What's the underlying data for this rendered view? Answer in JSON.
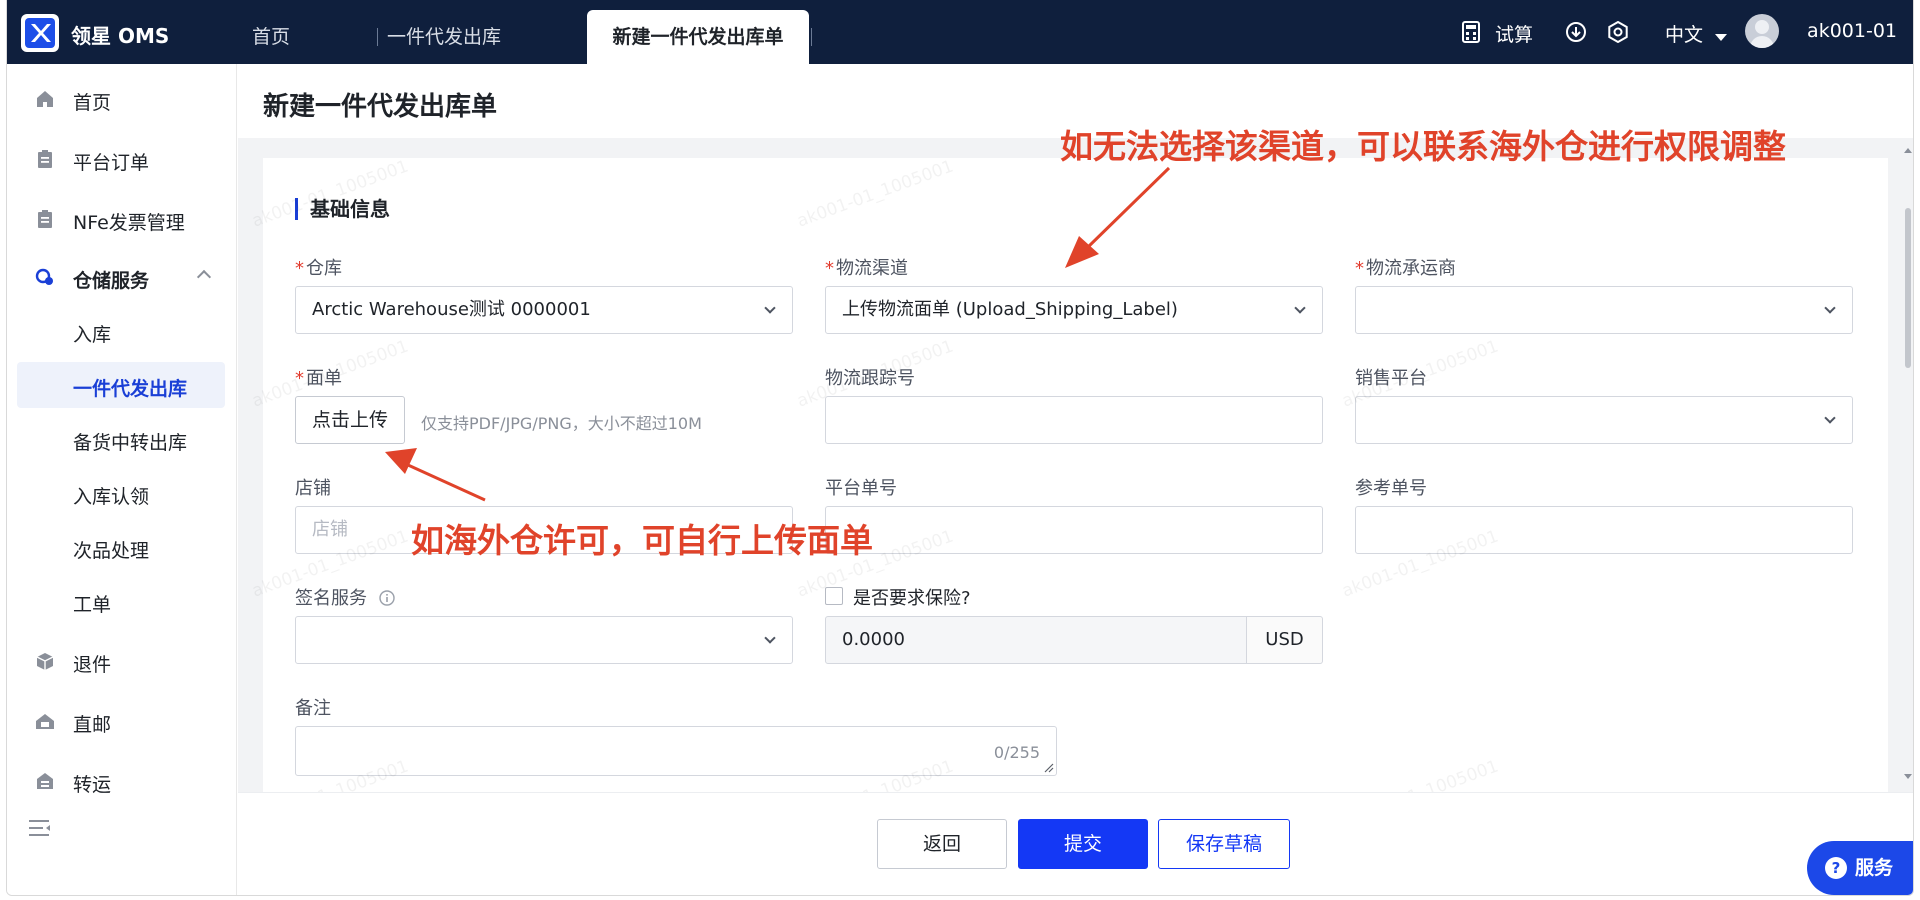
{
  "app": {
    "name": "领星 OMS"
  },
  "tabs": [
    {
      "label": "首页"
    },
    {
      "label": "一件代发出库"
    },
    {
      "label": "新建一件代发出库单"
    }
  ],
  "header": {
    "trial_label": "试算",
    "language": "中文",
    "user": "ak001-01"
  },
  "sidebar": {
    "items": [
      {
        "label": "首页",
        "icon": "home-icon"
      },
      {
        "label": "平台订单",
        "icon": "clipboard-icon"
      },
      {
        "label": "NFe发票管理",
        "icon": "clipboard-icon"
      },
      {
        "label": "仓储服务",
        "icon": "warehouse-service-icon"
      },
      {
        "label": "入库"
      },
      {
        "label": "一件代发出库"
      },
      {
        "label": "备货中转出库"
      },
      {
        "label": "入库认领"
      },
      {
        "label": "次品处理"
      },
      {
        "label": "工单"
      },
      {
        "label": "退件",
        "icon": "return-icon"
      },
      {
        "label": "直邮",
        "icon": "direct-mail-icon"
      },
      {
        "label": "转运",
        "icon": "transfer-icon"
      }
    ]
  },
  "page": {
    "title": "新建一件代发出库单"
  },
  "form": {
    "section_title": "基础信息",
    "warehouse": {
      "label": "仓库",
      "value": "Arctic Warehouse测试 0000001"
    },
    "channel": {
      "label": "物流渠道",
      "value": "上传物流面单 (Upload_Shipping_Label)"
    },
    "carrier": {
      "label": "物流承运商",
      "value": ""
    },
    "label_sheet": {
      "label": "面单",
      "button": "点击上传",
      "hint": "仅支持PDF/JPG/PNG，大小不超过10M"
    },
    "tracking": {
      "label": "物流跟踪号",
      "value": ""
    },
    "platform": {
      "label": "销售平台",
      "value": ""
    },
    "shop": {
      "label": "店铺",
      "placeholder": "店铺"
    },
    "platform_order": {
      "label": "平台单号",
      "value": ""
    },
    "reference": {
      "label": "参考单号",
      "value": ""
    },
    "signature": {
      "label": "签名服务",
      "value": ""
    },
    "insurance": {
      "label": "是否要求保险?",
      "checked": false,
      "amount": "0.0000",
      "currency": "USD"
    },
    "remark": {
      "label": "备注",
      "counter": "0/255"
    }
  },
  "footer": {
    "back": "返回",
    "submit": "提交",
    "draft": "保存草稿"
  },
  "service_button": "服务",
  "watermark": "ak001-01_1005001",
  "annotations": {
    "channel_note": "如无法选择该渠道，可以联系海外仓进行权限调整",
    "upload_note": "如海外仓许可，可自行上传面单"
  },
  "colors": {
    "topbar": "#0f1f3d",
    "primary": "#1438f5",
    "annotation": "#e0432a",
    "required": "#e23b2e"
  }
}
